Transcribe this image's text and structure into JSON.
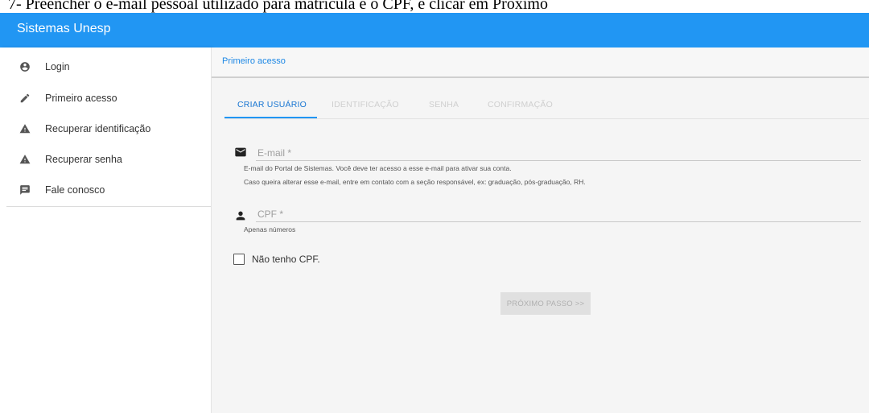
{
  "caption": "7- Preencher o e-mail pessoal utilizado para matrícula e o CPF, e clicar em Próximo",
  "colors": {
    "primary": "#2196f3",
    "active_tab": "#1976d2",
    "background": "#f5f5f5"
  },
  "appbar": {
    "title": "Sistemas Unesp"
  },
  "sidebar": {
    "items": [
      {
        "icon": "account-circle-icon",
        "label": "Login"
      },
      {
        "icon": "pencil-icon",
        "label": "Primeiro acesso"
      },
      {
        "icon": "warning-icon",
        "label": "Recuperar identificação"
      },
      {
        "icon": "warning-icon",
        "label": "Recuperar senha"
      },
      {
        "icon": "feedback-icon",
        "label": "Fale conosco"
      }
    ]
  },
  "main": {
    "breadcrumb": "Primeiro acesso",
    "tabs": [
      {
        "label": "Criar usuário",
        "active": true
      },
      {
        "label": "Identificação",
        "active": false
      },
      {
        "label": "Senha",
        "active": false
      },
      {
        "label": "Confirmação",
        "active": false
      }
    ],
    "email": {
      "placeholder": "E-mail *",
      "value": "",
      "hint1": "E-mail do Portal de Sistemas. Você deve ter acesso a esse e-mail para ativar sua conta.",
      "hint2": "Caso queira alterar esse e-mail, entre em contato com a seção responsável, ex: graduação, pós-graduação, RH."
    },
    "cpf": {
      "placeholder": "CPF *",
      "value": "",
      "hint": "Apenas números"
    },
    "no_cpf_checkbox": {
      "label": "Não tenho CPF.",
      "checked": false
    },
    "next_button": "Próximo passo >>"
  }
}
